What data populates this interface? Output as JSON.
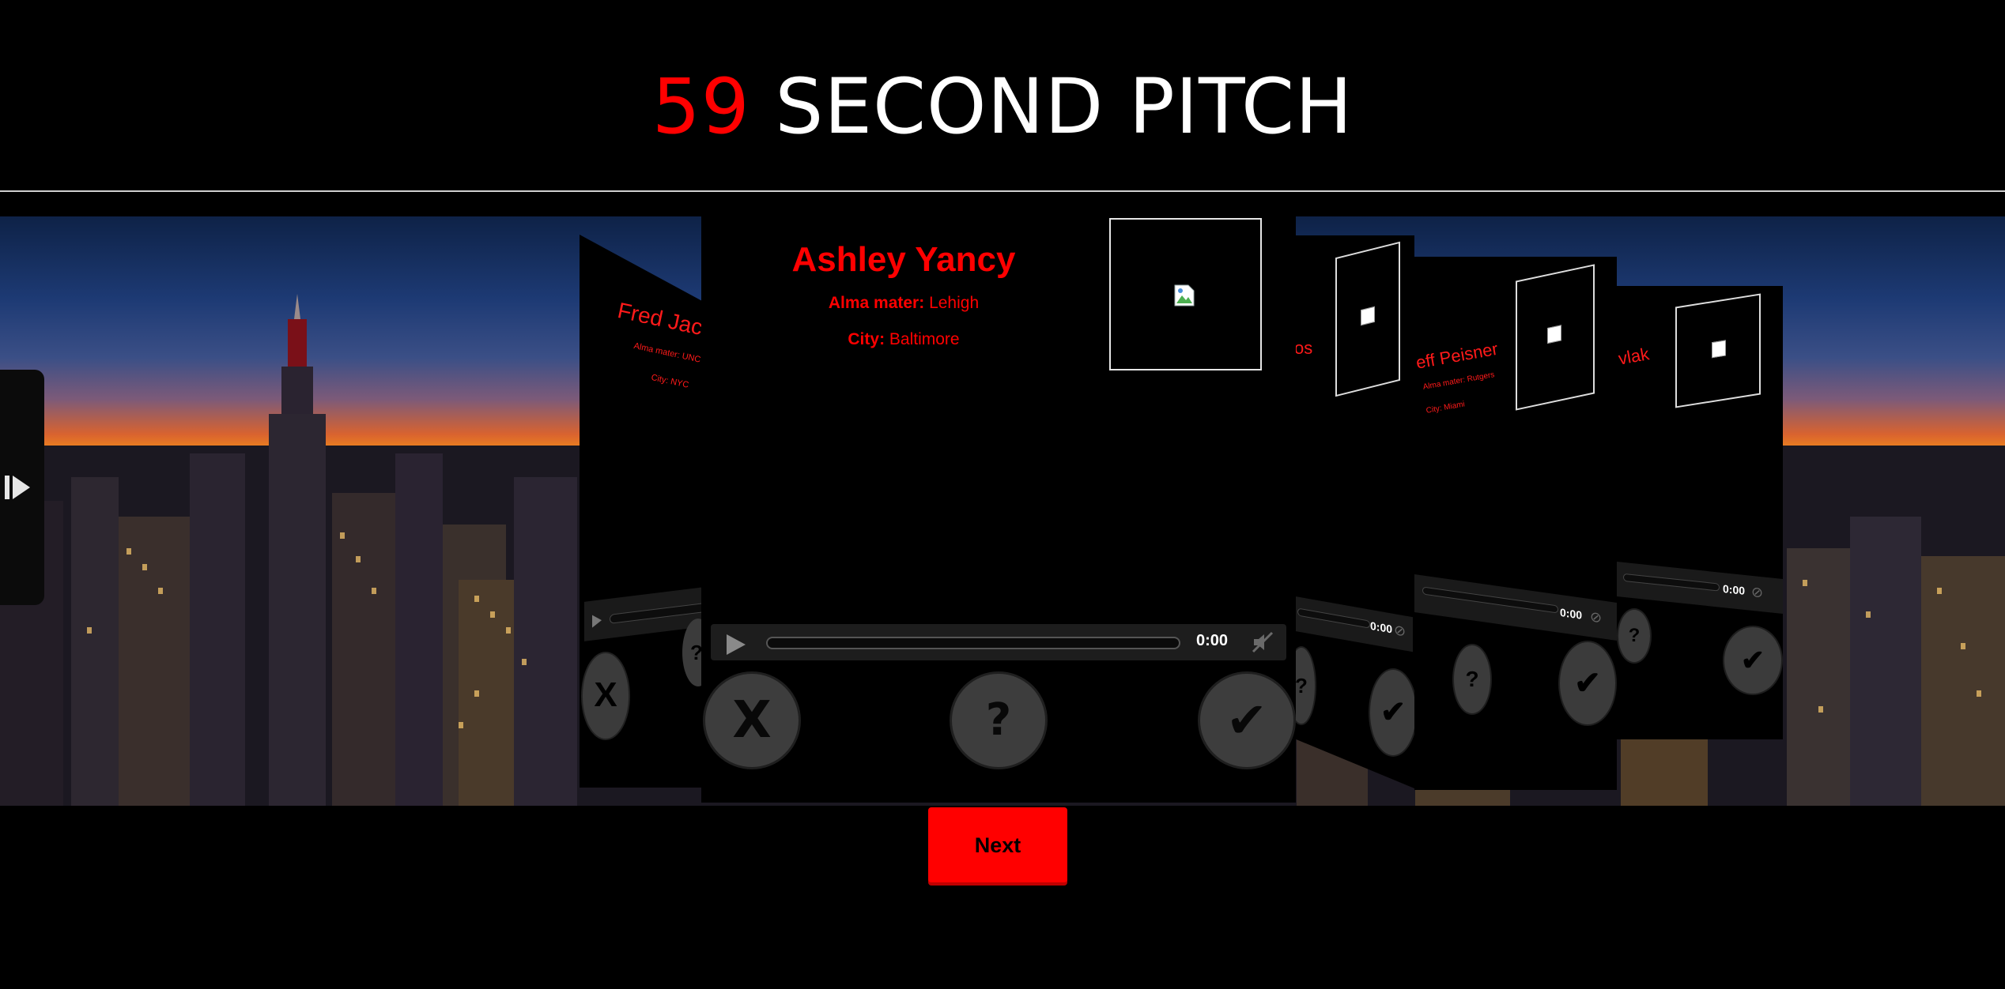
{
  "header": {
    "logo_number": "59",
    "logo_text": "SECOND PITCH"
  },
  "current_pitch": {
    "name": "Ashley Yancy",
    "alma_mater_label": "Alma mater:",
    "alma_mater_value": "Lehigh",
    "city_label": "City:",
    "city_value": "Baltimore",
    "time": "0:00"
  },
  "side_cards": {
    "left": {
      "name": "Fred Jackson",
      "alma_mater_text": "Alma mater: UNC",
      "city_text": "City: NYC"
    },
    "right_1": {
      "name_fragment": "os",
      "time": "0:00"
    },
    "right_2": {
      "name_fragment": "eff Peisner",
      "alma_mater_text": "Alma mater: Rutgers",
      "city_text": "City: Miami",
      "time": "0:00"
    },
    "right_3": {
      "name_fragment": "vlak",
      "time": "0:00"
    }
  },
  "buttons": {
    "reject": "X",
    "maybe": "?",
    "accept": "✔",
    "next": "Next"
  },
  "colors": {
    "accent_red": "#ff0000",
    "background": "#000000",
    "button_gray": "#3d3d3d"
  }
}
